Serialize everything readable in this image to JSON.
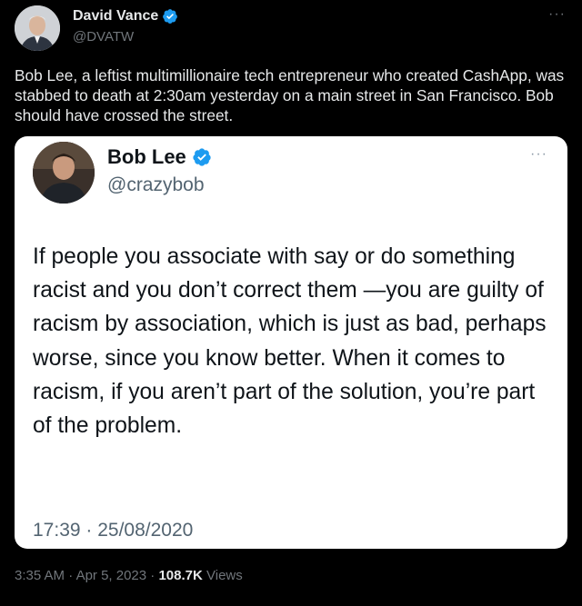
{
  "tweet": {
    "author": {
      "name": "David Vance",
      "handle": "@DVATW",
      "verified": true
    },
    "more_icon": "more-horizontal-icon",
    "text": "Bob Lee, a leftist multimillionaire tech entrepreneur who created CashApp, was stabbed to death at 2:30am yesterday on a main street in San Francisco. Bob should have crossed the street.",
    "quoted": {
      "author": {
        "name": "Bob Lee",
        "handle": "@crazybob",
        "verified": true
      },
      "text": "If people you associate with say or do something racist and you don’t correct them —you are guilty of racism by association, which is just as bad, perhaps worse, since you know better. When it comes to racism, if you aren’t part of the solution, you’re part of the problem.",
      "timestamp": "17:39 · 25/08/2020"
    },
    "meta": {
      "time": "3:35 AM",
      "date": "Apr 5, 2023",
      "separator": "·",
      "views_count": "108.7K",
      "views_label": "Views"
    },
    "colors": {
      "background": "#000000",
      "verified": "#1d9bf0",
      "text_primary": "#e7e9ea",
      "text_secondary": "#71767b",
      "card_background": "#ffffff"
    }
  }
}
